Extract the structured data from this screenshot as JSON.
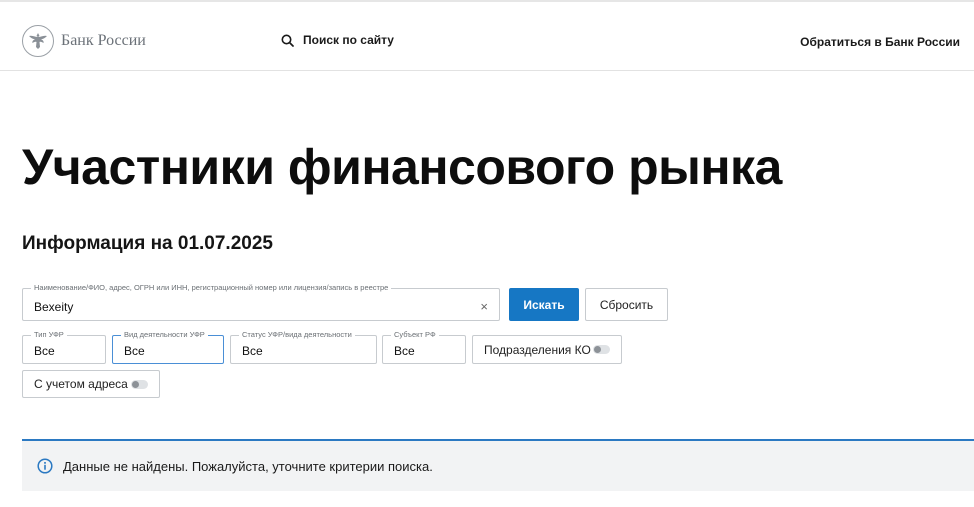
{
  "header": {
    "logo_text": "Банк России",
    "search_label": "Поиск по сайту",
    "contact_label": "Обратиться в Банк России"
  },
  "page": {
    "title": "Участники финансового рынка",
    "subtitle": "Информация на 01.07.2025"
  },
  "search": {
    "legend": "Наименование/ФИО, адрес, ОГРН или ИНН, регистрационный номер или лицензия/запись в реестре",
    "value": "Bexeity",
    "clear_symbol": "×",
    "search_button": "Искать",
    "reset_button": "Сбросить"
  },
  "filters": {
    "type": {
      "legend": "Тип УФР",
      "value": "Все"
    },
    "activity": {
      "legend": "Вид деятельности УФР",
      "value": "Все"
    },
    "status": {
      "legend": "Статус УФР/вида деятельности",
      "value": "Все"
    },
    "region": {
      "legend": "Субъект РФ",
      "value": "Все"
    },
    "ko_divisions": {
      "label": "Подразделения КО",
      "enabled": false
    },
    "with_address": {
      "label": "С учетом адреса",
      "enabled": false
    }
  },
  "notice": {
    "text": "Данные не найдены. Пожалуйста, уточните критерии поиска."
  },
  "colors": {
    "primary": "#1677c4",
    "notice_border": "#2b79c2",
    "notice_bg": "#f2f3f4",
    "active_field_border": "#4a8fd6"
  }
}
